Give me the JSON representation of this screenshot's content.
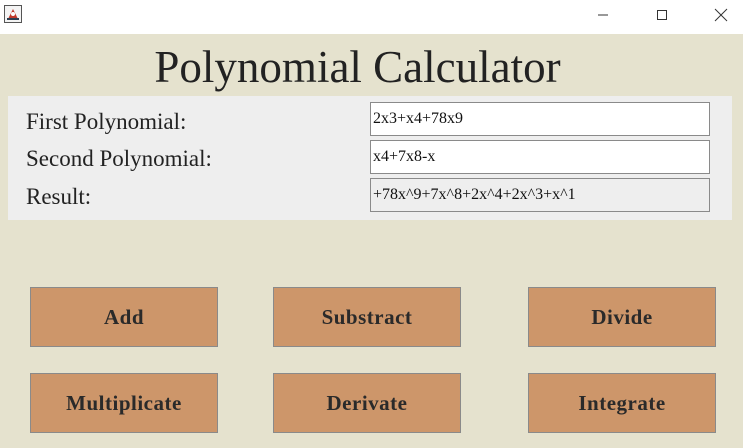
{
  "window": {
    "minimize_icon": "minimize-icon",
    "maximize_icon": "maximize-icon",
    "close_icon": "close-icon",
    "app_icon": "java-app-icon"
  },
  "app": {
    "title": "Polynomial Calculator"
  },
  "form": {
    "first_label": "First Polynomial:",
    "first_value": "2x3+x4+78x9",
    "second_label": "Second Polynomial:",
    "second_value": "x4+7x8-x",
    "result_label": "Result:",
    "result_value": "+78x^9+7x^8+2x^4+2x^3+x^1"
  },
  "buttons": {
    "add": "Add",
    "subtract": "Substract",
    "divide": "Divide",
    "multiply": "Multiplicate",
    "derive": "Derivate",
    "integrate": "Integrate"
  },
  "colors": {
    "background": "#e5e2ce",
    "panel": "#eeeeee",
    "button": "#cd966a"
  }
}
